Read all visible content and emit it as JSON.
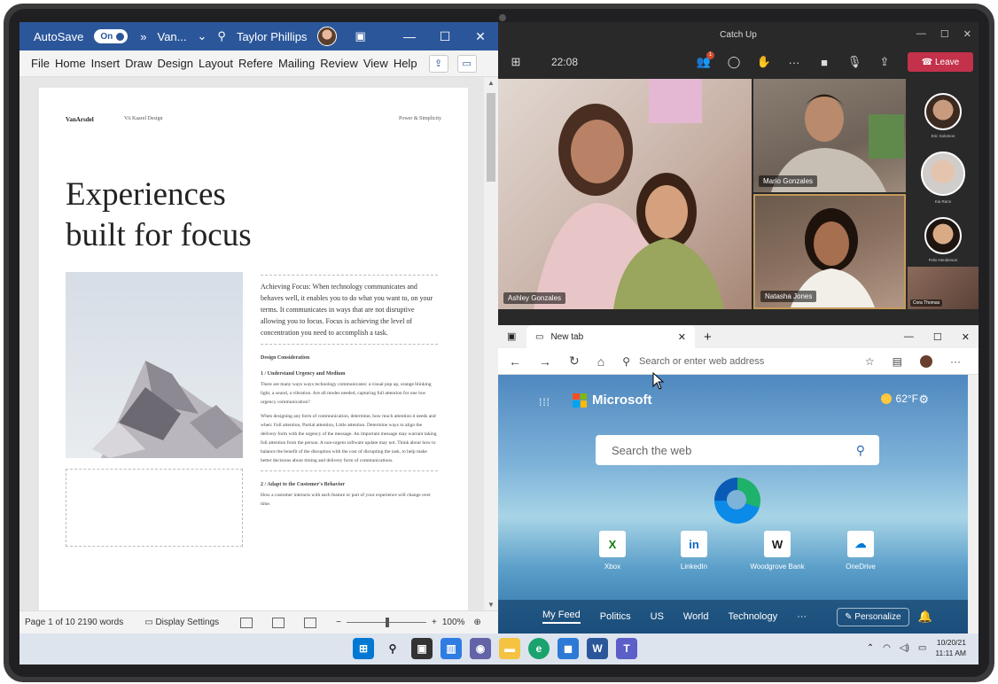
{
  "word": {
    "autosave_label": "AutoSave",
    "autosave_state": "On",
    "chevron": "»",
    "doc_name": "Van...",
    "user_name": "Taylor Phillips",
    "ribbon_tabs": [
      "File",
      "Home",
      "Insert",
      "Draw",
      "Design",
      "Layout",
      "Refere",
      "Mailing",
      "Review",
      "View",
      "Help"
    ],
    "doc": {
      "header_left": "VanArsdel",
      "header_mid": "VA Kaarel Design",
      "header_right": "Power & Simplicity",
      "title_line1": "Experiences",
      "title_line2": "built for focus",
      "lead": "Achieving Focus: When technology communicates and behaves well, it enables you to do what you want to, on your terms. It communicates in ways that are not disruptive allowing you to focus. Focus is achieving the level of concentration you need to accomplish a task.",
      "section_title": "Design Consideration",
      "sub1": "1 / Understand Urgency and Medium",
      "p1": "There are many ways ways technology communicates: a visual pop up, orange blinking light, a sound, a vibration. Are all modes needed, capturing full attention for one low urgency communication?",
      "p2": "When designing any form of communication, determine, how much attention it needs and when: Full attention, Partial attention, Little attention. Determine ways to align the delivery form with the urgency of the message. An important message may warrant taking full attention from the person. A non-urgent software update may not. Think about how to balance the benefit of the disruption with the cost of disrupting the task, to help make better decisions about timing and delivery form of communications.",
      "sub2": "2 / Adapt to the Customer's Behavior",
      "p3": "How a customer interacts with each feature or part of your experience will change over time."
    },
    "status": {
      "page": "Page 1 of 10",
      "words": "2190 words",
      "display_settings": "Display Settings",
      "zoom": "100%",
      "minus": "−",
      "plus": "+"
    }
  },
  "teams": {
    "title": "Catch Up",
    "time": "22:08",
    "leave_label": "Leave",
    "people_badge": "1",
    "participants": [
      {
        "name": "Ashley Gonzales"
      },
      {
        "name": "Mario Gonzales"
      },
      {
        "name": "Natasha Jones"
      }
    ],
    "side_participants": [
      "Eric Solomon",
      "Kia Rann",
      "Felix Henderson",
      "Cora Thomas"
    ]
  },
  "edge": {
    "tab_title": "New tab",
    "address_placeholder": "Search or enter web address",
    "brand": "Microsoft",
    "weather": "62°F",
    "search_placeholder": "Search the web",
    "tiles": [
      {
        "label": "Xbox",
        "icon": "X",
        "color": "#107c10"
      },
      {
        "label": "LinkedIn",
        "icon": "in",
        "color": "#0a66c2"
      },
      {
        "label": "Woodgrove Bank",
        "icon": "W",
        "color": "#1a1a1a"
      },
      {
        "label": "OneDrive",
        "icon": "☁",
        "color": "#0078d4"
      }
    ],
    "feed": [
      "My Feed",
      "Politics",
      "US",
      "World",
      "Technology",
      "···"
    ],
    "personalize": "Personalize"
  },
  "taskbar": {
    "date": "10/20/21",
    "time": "11:11 AM"
  },
  "colors": {
    "word_blue": "#2b579a",
    "teams_leave": "#c4314b",
    "taskbar": "#dde4ee"
  }
}
